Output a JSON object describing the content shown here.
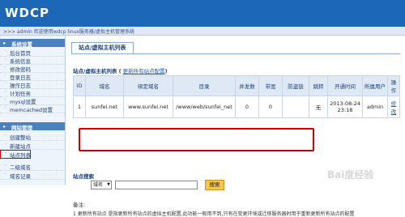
{
  "app": {
    "logo": "WDCP"
  },
  "breadcrumb": ">>> admin 欢迎使用wdcp linux服务器/虚拟主机管理系统",
  "sidebar": {
    "section1": "系统设置",
    "items1": [
      "后台首页",
      "系统信息",
      "修改密码",
      "登录日志",
      "操作日志",
      "计划任务",
      "mysql设置",
      "memcached设置"
    ],
    "section2": "网站管理",
    "items2": [
      "创建整站",
      "新建站点",
      "站点列表",
      "二级域名",
      "域名记录"
    ]
  },
  "main": {
    "tab": "站点/虚拟主机列表",
    "list_title": "站点/虚拟主机列表",
    "update_link": "更新所有站点配置",
    "columns": [
      "ID",
      "域名",
      "绑定域名",
      "目录",
      "并发数",
      "带宽",
      "防盗链",
      "跳转",
      "开通时间",
      "所属用户",
      "操作"
    ],
    "rows": [
      {
        "id": "1",
        "domain": "sunfei.net",
        "bind": "www.sunfei.net",
        "dir": "/www/web/sunfei_net",
        "conn": "0",
        "bw": "0",
        "anti": "",
        "redirect": "无",
        "time": "2013-08-24 23:18",
        "user": "admin",
        "op": "修改"
      }
    ],
    "search_title": "站点搜索",
    "search_select": "域名",
    "search_button": "搜索",
    "notes_title": "备注:",
    "notes_text": "1 更新所有站点 是指更新所有站点的虚拟主机配置,此功能一般用不到,只有在变更环境或迁移服务器时用于重新更新所有站点的配置"
  },
  "watermark": "Bai度经验"
}
